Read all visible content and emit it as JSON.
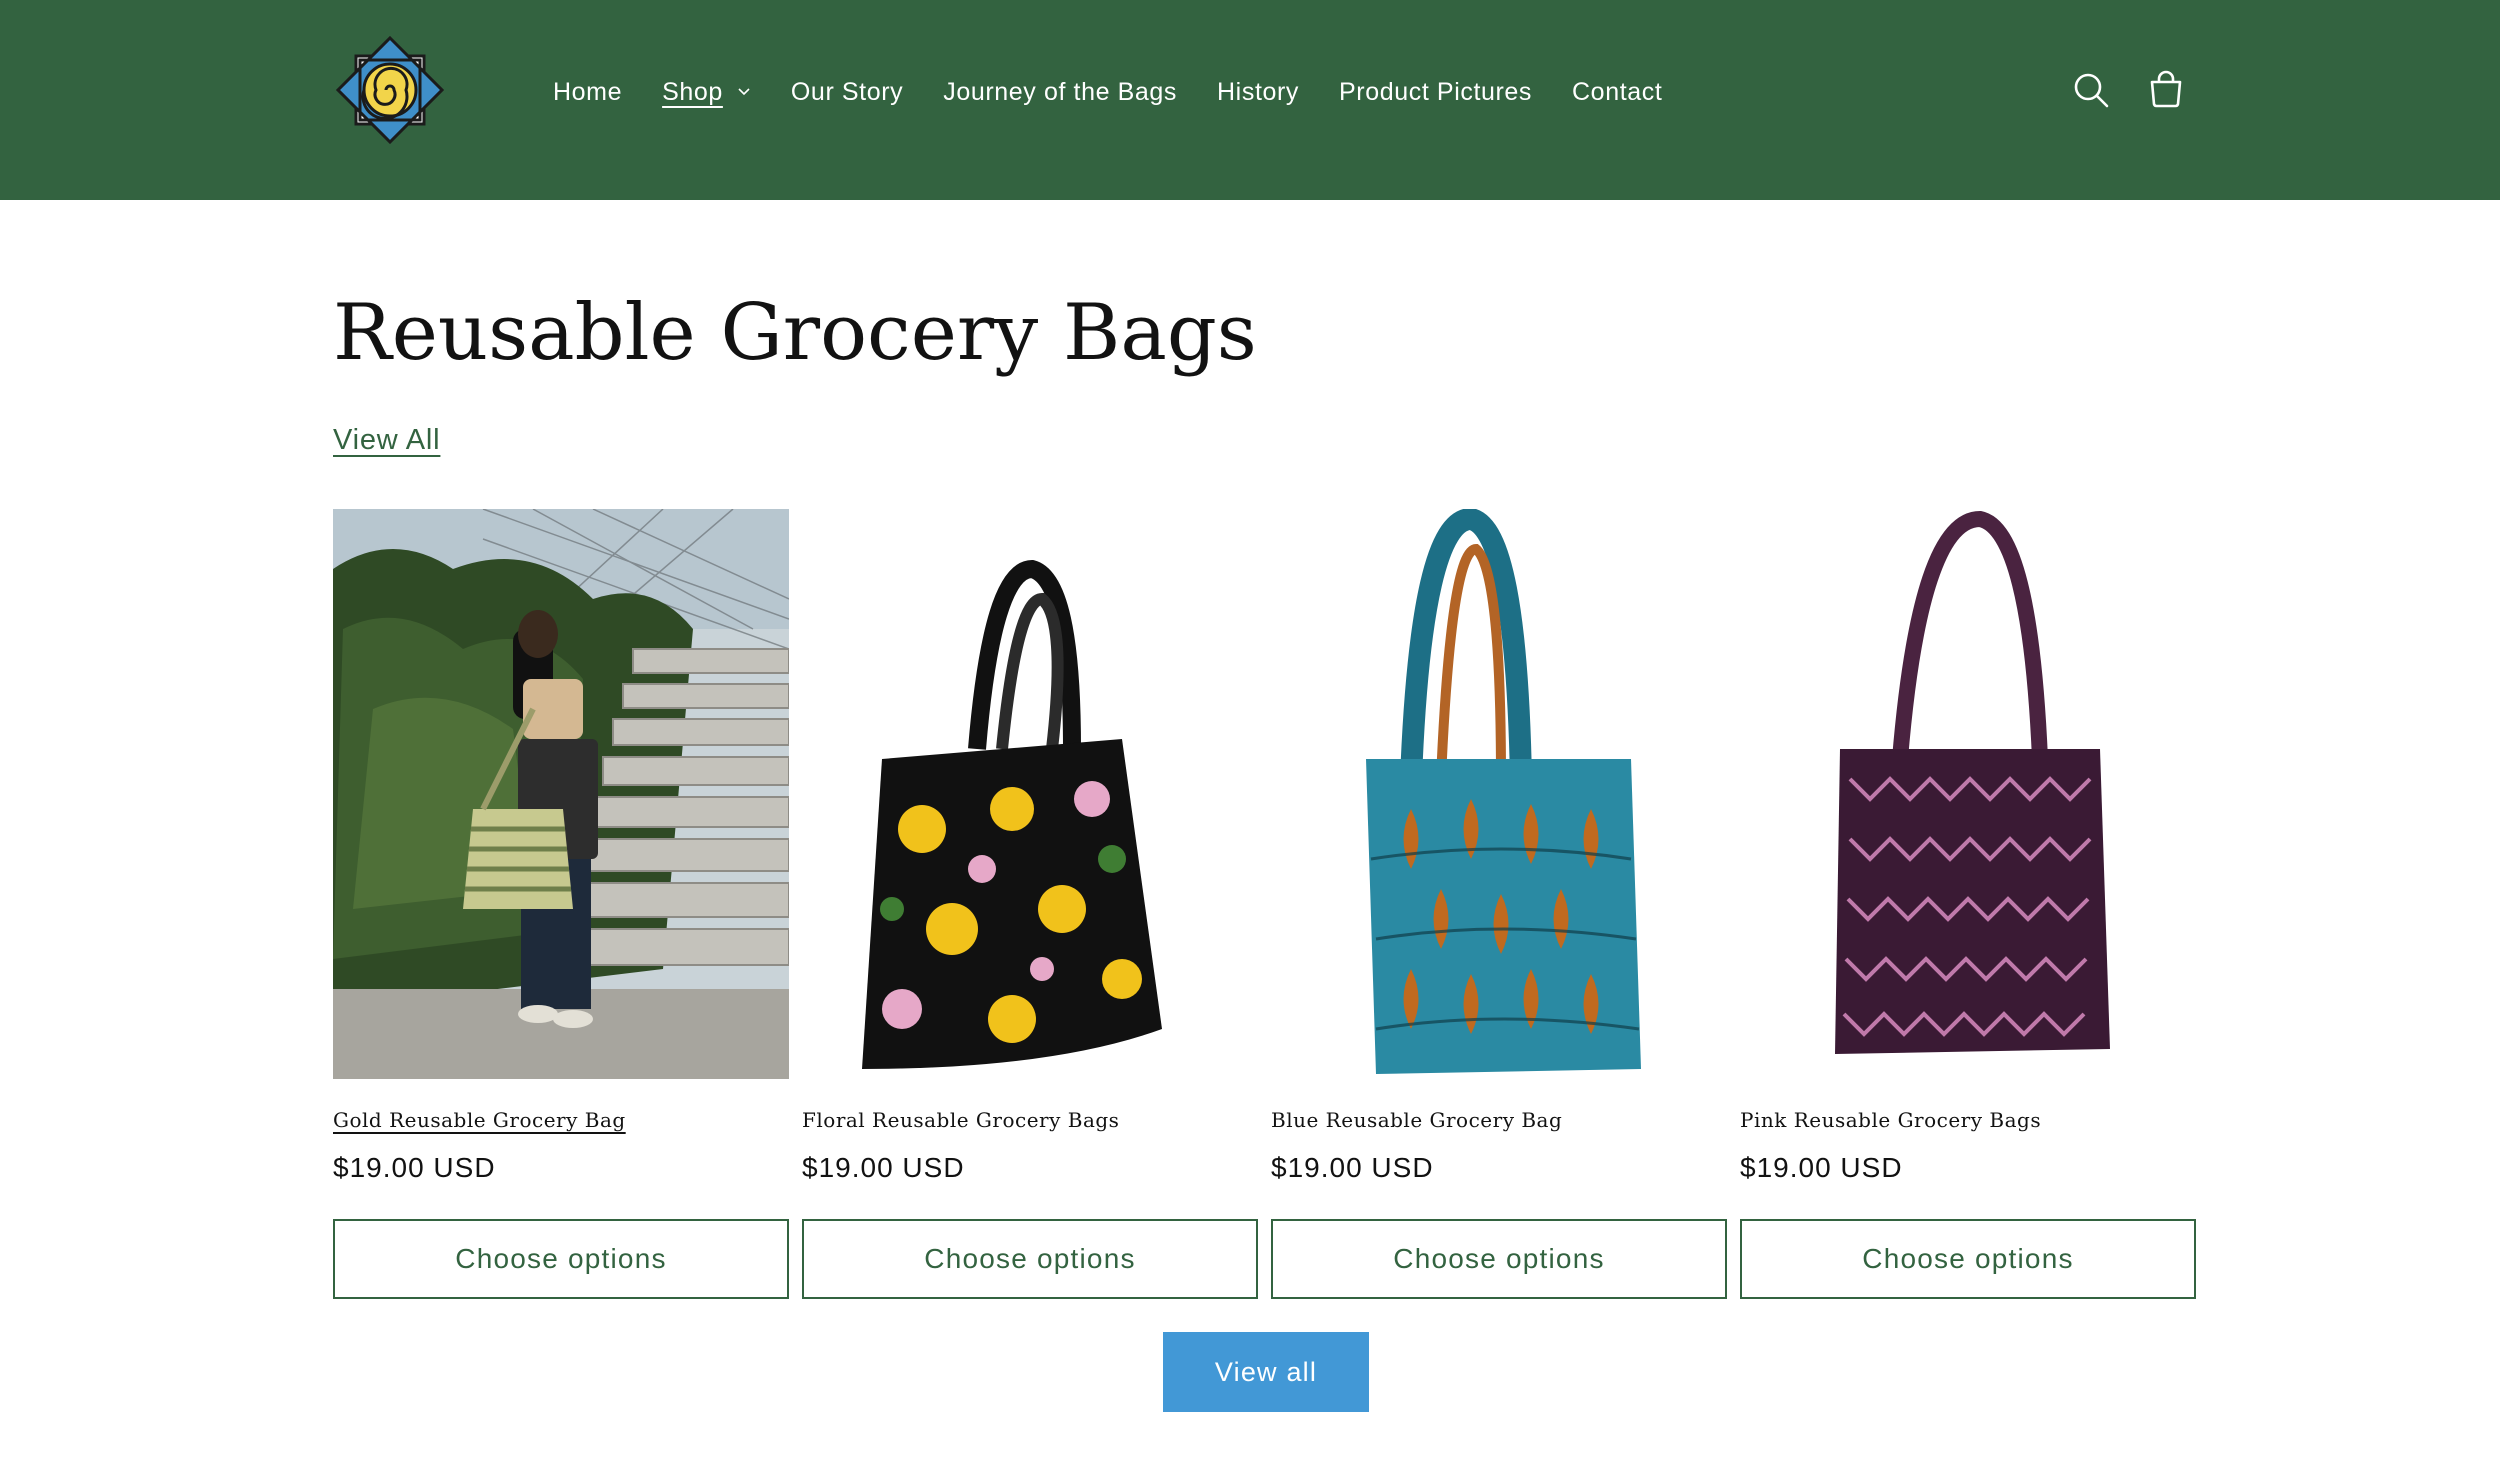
{
  "header": {
    "logo": "spiral-logo",
    "nav": [
      {
        "label": "Home"
      },
      {
        "label": "Shop",
        "active": true,
        "has_dropdown": true
      },
      {
        "label": "Our Story"
      },
      {
        "label": "Journey of the Bags"
      },
      {
        "label": "History"
      },
      {
        "label": "Product Pictures"
      },
      {
        "label": "Contact"
      }
    ],
    "icons": [
      "search-icon",
      "cart-icon"
    ],
    "background": "#336340"
  },
  "collection": {
    "title": "Reusable Grocery Bags",
    "view_all_link": "View All",
    "view_all_button": "View all",
    "products": [
      {
        "name": "Gold Reusable Grocery Bag",
        "price": "$19.00 USD",
        "button": "Choose options"
      },
      {
        "name": "Floral Reusable Grocery Bags",
        "price": "$19.00 USD",
        "button": "Choose options"
      },
      {
        "name": "Blue Reusable Grocery Bag",
        "price": "$19.00 USD",
        "button": "Choose options"
      },
      {
        "name": "Pink Reusable Grocery Bags",
        "price": "$19.00 USD",
        "button": "Choose options"
      }
    ]
  },
  "colors": {
    "accent": "#336340",
    "button_primary": "#4298d6"
  }
}
